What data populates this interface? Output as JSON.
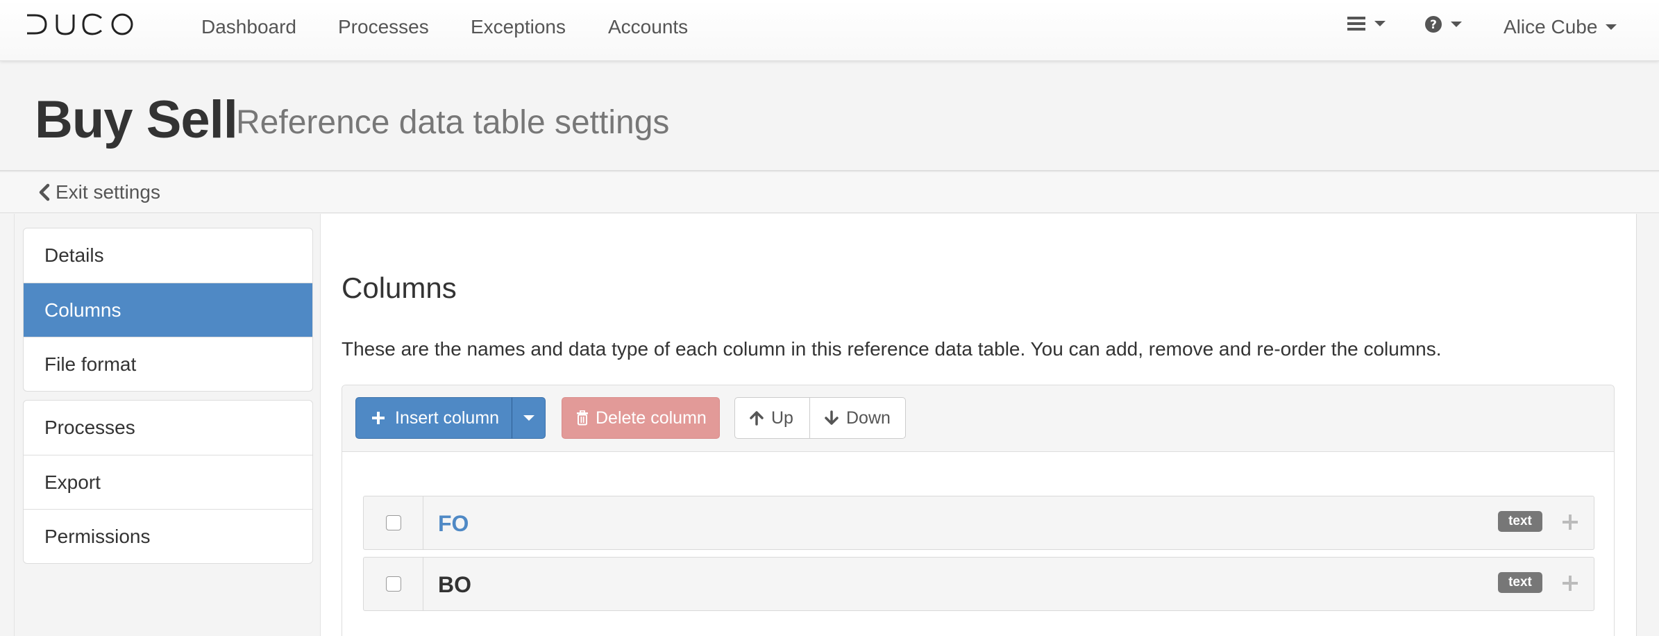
{
  "navbar": {
    "brand": "DUCO",
    "links": [
      "Dashboard",
      "Processes",
      "Exceptions",
      "Accounts"
    ],
    "menu_icon": "hamburger-icon",
    "help_icon": "question-circle-icon",
    "user_name": "Alice Cube"
  },
  "header": {
    "title": "Buy Sell",
    "subtitle": "Reference data table settings"
  },
  "exit": {
    "label": "Exit settings",
    "icon": "chevron-left-icon"
  },
  "sidebar": {
    "group1": [
      {
        "label": "Details",
        "active": false
      },
      {
        "label": "Columns",
        "active": true
      },
      {
        "label": "File format",
        "active": false
      }
    ],
    "group2": [
      {
        "label": "Processes",
        "active": false
      },
      {
        "label": "Export",
        "active": false
      },
      {
        "label": "Permissions",
        "active": false
      }
    ]
  },
  "main": {
    "title": "Columns",
    "description": "These are the names and data type of each column in this reference data table. You can add, remove and re-order the columns.",
    "toolbar": {
      "insert_label": "Insert column",
      "delete_label": "Delete column",
      "up_label": "Up",
      "down_label": "Down"
    },
    "columns": [
      {
        "name": "FO",
        "type": "text",
        "checked": false
      },
      {
        "name": "BO",
        "type": "text",
        "checked": false
      }
    ]
  },
  "colors": {
    "primary": "#4f89c5",
    "danger_disabled": "#e29a98",
    "badge": "#777777",
    "header_bg": "#f4f4f4"
  }
}
